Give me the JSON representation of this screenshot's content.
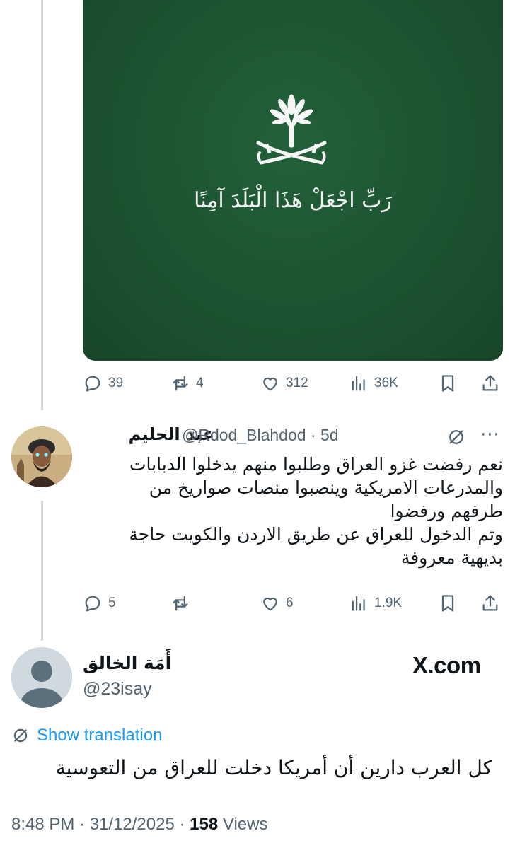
{
  "media": {
    "caption": "رَبِّ اجْعَلْ هَذَا الْبَلَدَ آمِنًا",
    "colors": {
      "background": "#1c5432",
      "emblem": "#f5f5f5"
    }
  },
  "top_post": {
    "actions": {
      "replies": "39",
      "reposts": "4",
      "likes": "312",
      "views": "36K"
    }
  },
  "reply": {
    "name": "عبد الحليم",
    "handle_and_time": "@Rdod_Blahdod · 5d",
    "text_lines": [
      "نعم رفضت غزو العراق وطلبوا منهم يدخلوا الدبابات",
      "والمدرعات الامريكية وينصبوا منصات صواريخ من",
      "طرفهم ورفضوا",
      "وتم الدخول للعراق عن طريق الاردن والكويت حاجة",
      "بديهية معروفة"
    ],
    "more": "···",
    "actions": {
      "replies": "5",
      "reposts": "",
      "likes": "6",
      "views": "1.9K"
    }
  },
  "main_post": {
    "name": "أَمَة الخالق",
    "handle": "@23isay",
    "watermark": "X.com",
    "translation_label": "Show translation",
    "text": "كل العرب دارين أن أمريكا دخلت للعراق من التعوسية",
    "time_date": "8:48 PM · 31/12/2025 · ",
    "views_count": "158",
    "views_label": " Views"
  },
  "colors": {
    "accent": "#1d9bf0",
    "muted": "#536471",
    "thread_line": "#cfd9de"
  }
}
